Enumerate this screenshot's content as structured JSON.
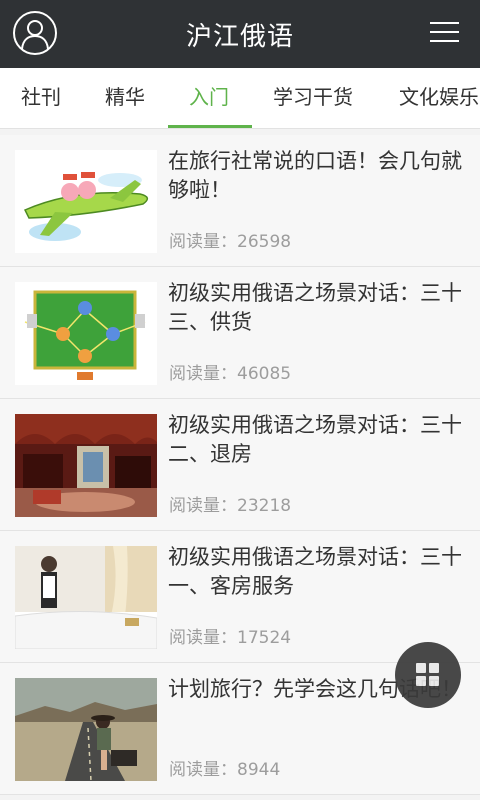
{
  "header": {
    "title": "沪江俄语",
    "avatar_icon": "user-avatar-icon",
    "menu_icon": "hamburger-menu-icon"
  },
  "tabs": [
    {
      "label": "社刊",
      "active": false
    },
    {
      "label": "精华",
      "active": false
    },
    {
      "label": "入门",
      "active": true
    },
    {
      "label": "学习干货",
      "active": false
    },
    {
      "label": "文化娱乐",
      "active": false
    }
  ],
  "accent_color": "#5fb34b",
  "articles": [
    {
      "title": "在旅行社常说的口语！会几句就够啦！",
      "read_label": "阅读量：",
      "reads": "26598",
      "thumb": "cartoon-airplane-travelers"
    },
    {
      "title": "初级实用俄语之场景对话：三十三、供货",
      "read_label": "阅读量：",
      "reads": "46085",
      "thumb": "supply-network-diagram"
    },
    {
      "title": "初级实用俄语之场景对话：三十二、退房",
      "read_label": "阅读量：",
      "reads": "23218",
      "thumb": "hotel-room-interior"
    },
    {
      "title": "初级实用俄语之场景对话：三十一、客房服务",
      "read_label": "阅读量：",
      "reads": "17524",
      "thumb": "maid-room-service"
    },
    {
      "title": "计划旅行？先学会这几句话吧！",
      "read_label": "阅读量：",
      "reads": "8944",
      "thumb": "woman-on-road-with-suitcase"
    }
  ],
  "fab_icon": "grid-apps-icon"
}
